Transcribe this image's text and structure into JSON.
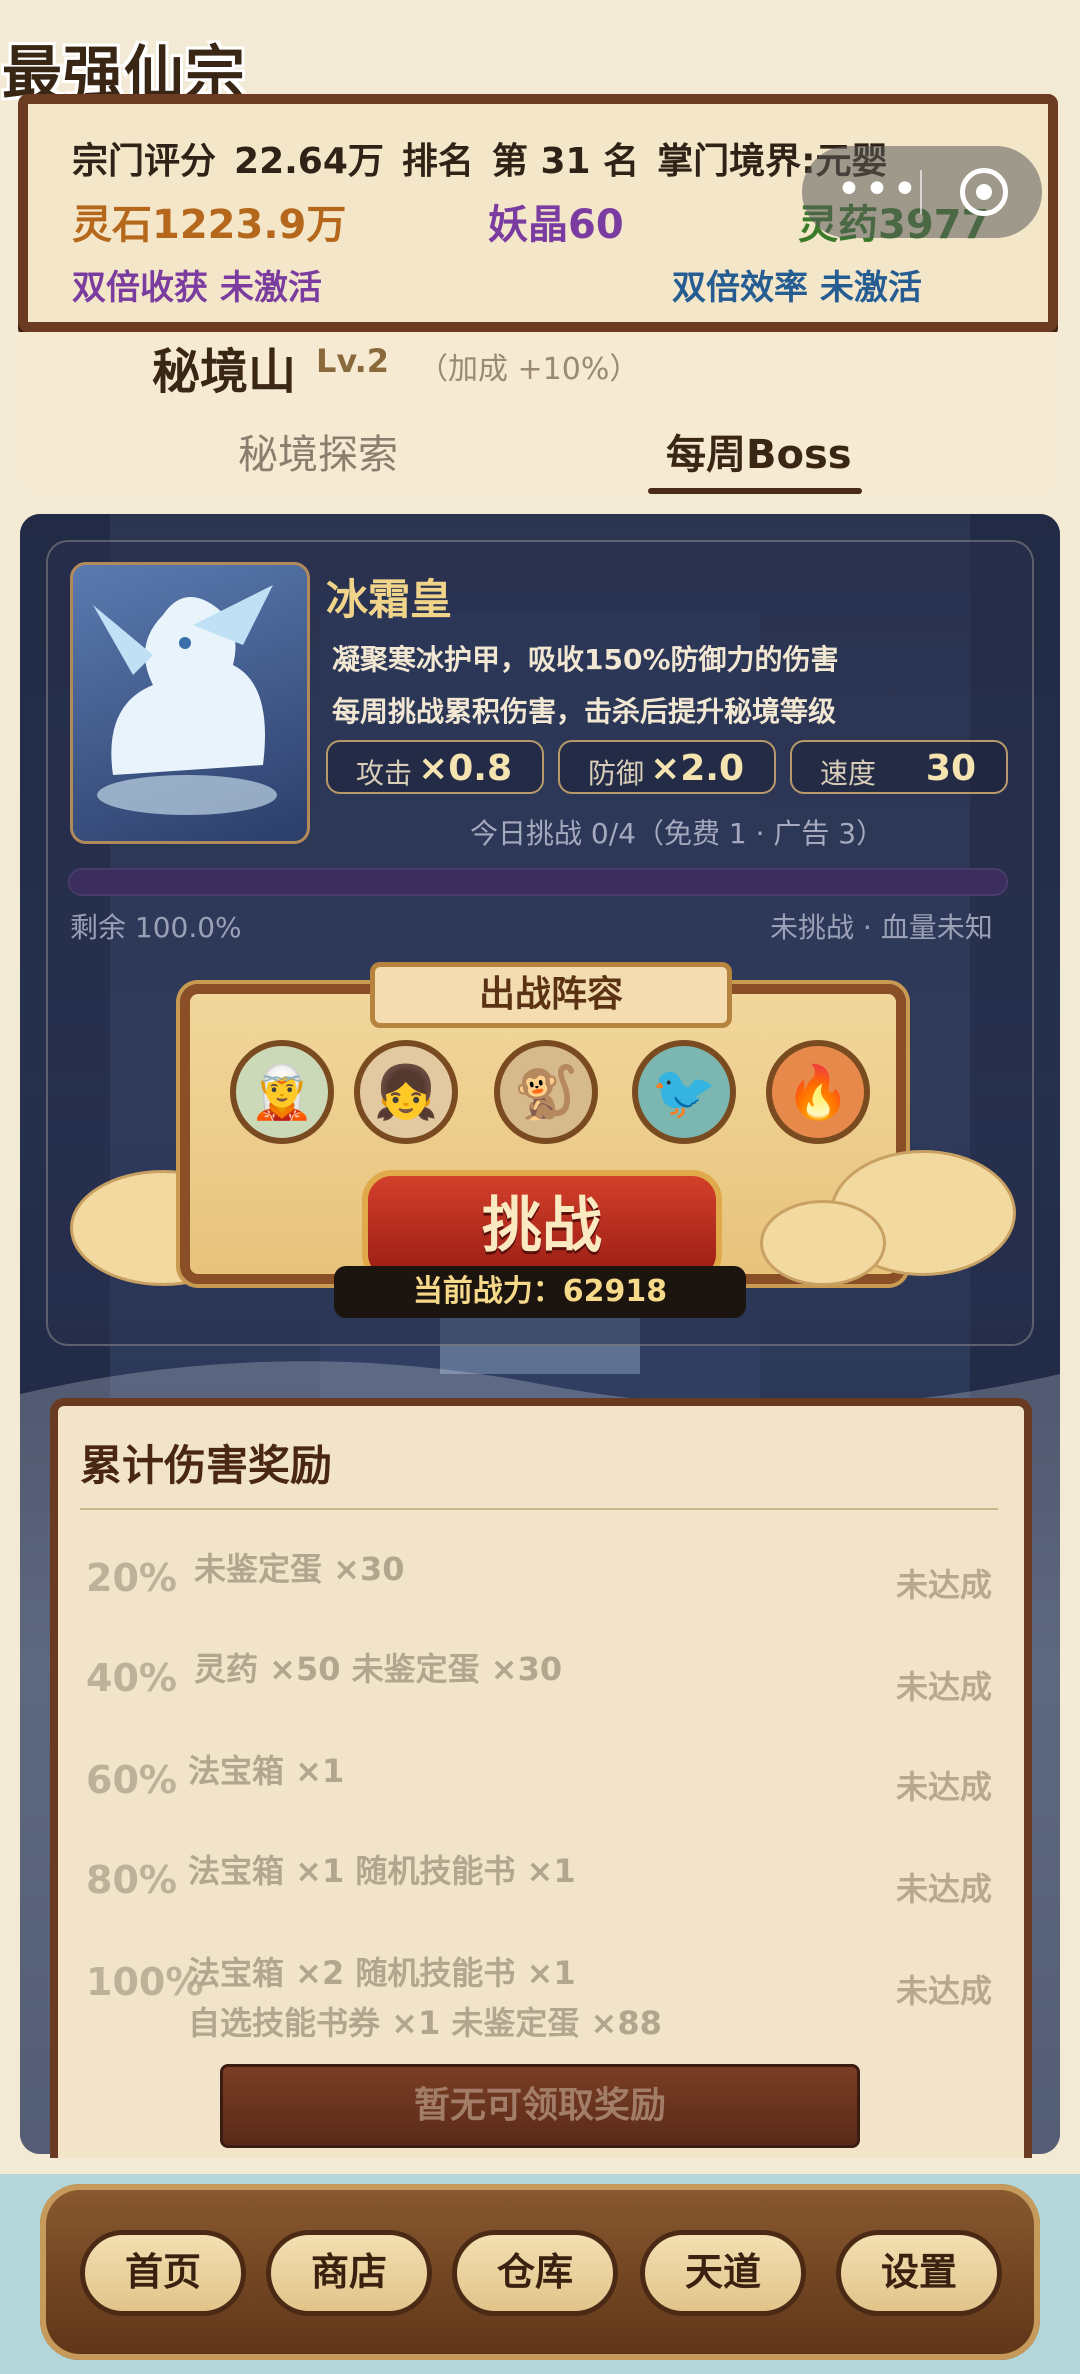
{
  "app_title": "最强仙宗",
  "header": {
    "sect_score_label": "宗门评分",
    "sect_score": "22.64万",
    "rank_label": "排名",
    "rank": "第 31 名",
    "realm_label": "掌门境界:元婴",
    "spirit_stone": "灵石1223.9万",
    "demon_crystal": "妖晶60",
    "herbs": "灵药3977",
    "double_harvest": "双倍收获  未激活",
    "double_efficiency": "双倍效率  未激活",
    "colors": {
      "stone": "#b5681c",
      "crystal": "#7a3ca0",
      "herb": "#3a7a2a",
      "harvest": "#7b3ca0",
      "efficiency": "#255d93"
    }
  },
  "realm": {
    "name": "秘境山",
    "level": "Lv.2",
    "bonus": "（加成 +10%）",
    "tabs": [
      {
        "label": "秘境探索",
        "active": false
      },
      {
        "label": "每周Boss",
        "active": true
      }
    ]
  },
  "boss": {
    "name": "冰霜皇",
    "desc1": "凝聚寒冰护甲，吸收150%防御力的伤害",
    "desc2": "每周挑战累积伤害，击杀后提升秘境等级",
    "stats": [
      {
        "label": "攻击",
        "value": "×0.8"
      },
      {
        "label": "防御",
        "value": "×2.0"
      },
      {
        "label": "速度",
        "value": "30"
      }
    ],
    "challenge_count": "今日挑战 0/4（免费 1 · 广告 3）",
    "hp_remaining_fraction": 1.0,
    "remaining_text": "剩余 100.0%",
    "hp_status": "未挑战 · 血量未知"
  },
  "lineup": {
    "title": "出战阵容",
    "heroes": [
      {
        "icon": "maiden-icon",
        "glyph": "🧝"
      },
      {
        "icon": "girl-icon",
        "glyph": "👧"
      },
      {
        "icon": "monkey-icon",
        "glyph": "🐒"
      },
      {
        "icon": "azure-bird-icon",
        "glyph": "🐦"
      },
      {
        "icon": "phoenix-icon",
        "glyph": "🔥"
      }
    ],
    "challenge_label": "挑战",
    "power_text": "当前战力：62918"
  },
  "rewards": {
    "title": "累计伤害奖励",
    "rows": [
      {
        "pct": "20%",
        "items": [
          "未鉴定蛋 ×30"
        ],
        "status": "未达成"
      },
      {
        "pct": "40%",
        "items": [
          "灵药 ×50  未鉴定蛋 ×30"
        ],
        "status": "未达成"
      },
      {
        "pct": "60%",
        "items": [
          "法宝箱 ×1"
        ],
        "status": "未达成"
      },
      {
        "pct": "80%",
        "items": [
          "法宝箱 ×1  随机技能书 ×1"
        ],
        "status": "未达成"
      },
      {
        "pct": "100%",
        "items": [
          "法宝箱 ×2  随机技能书 ×1",
          "自选技能书券 ×1  未鉴定蛋 ×88"
        ],
        "status": "未达成"
      }
    ],
    "claim_label": "暂无可领取奖励"
  },
  "nav": [
    "首页",
    "商店",
    "仓库",
    "天道",
    "设置"
  ]
}
